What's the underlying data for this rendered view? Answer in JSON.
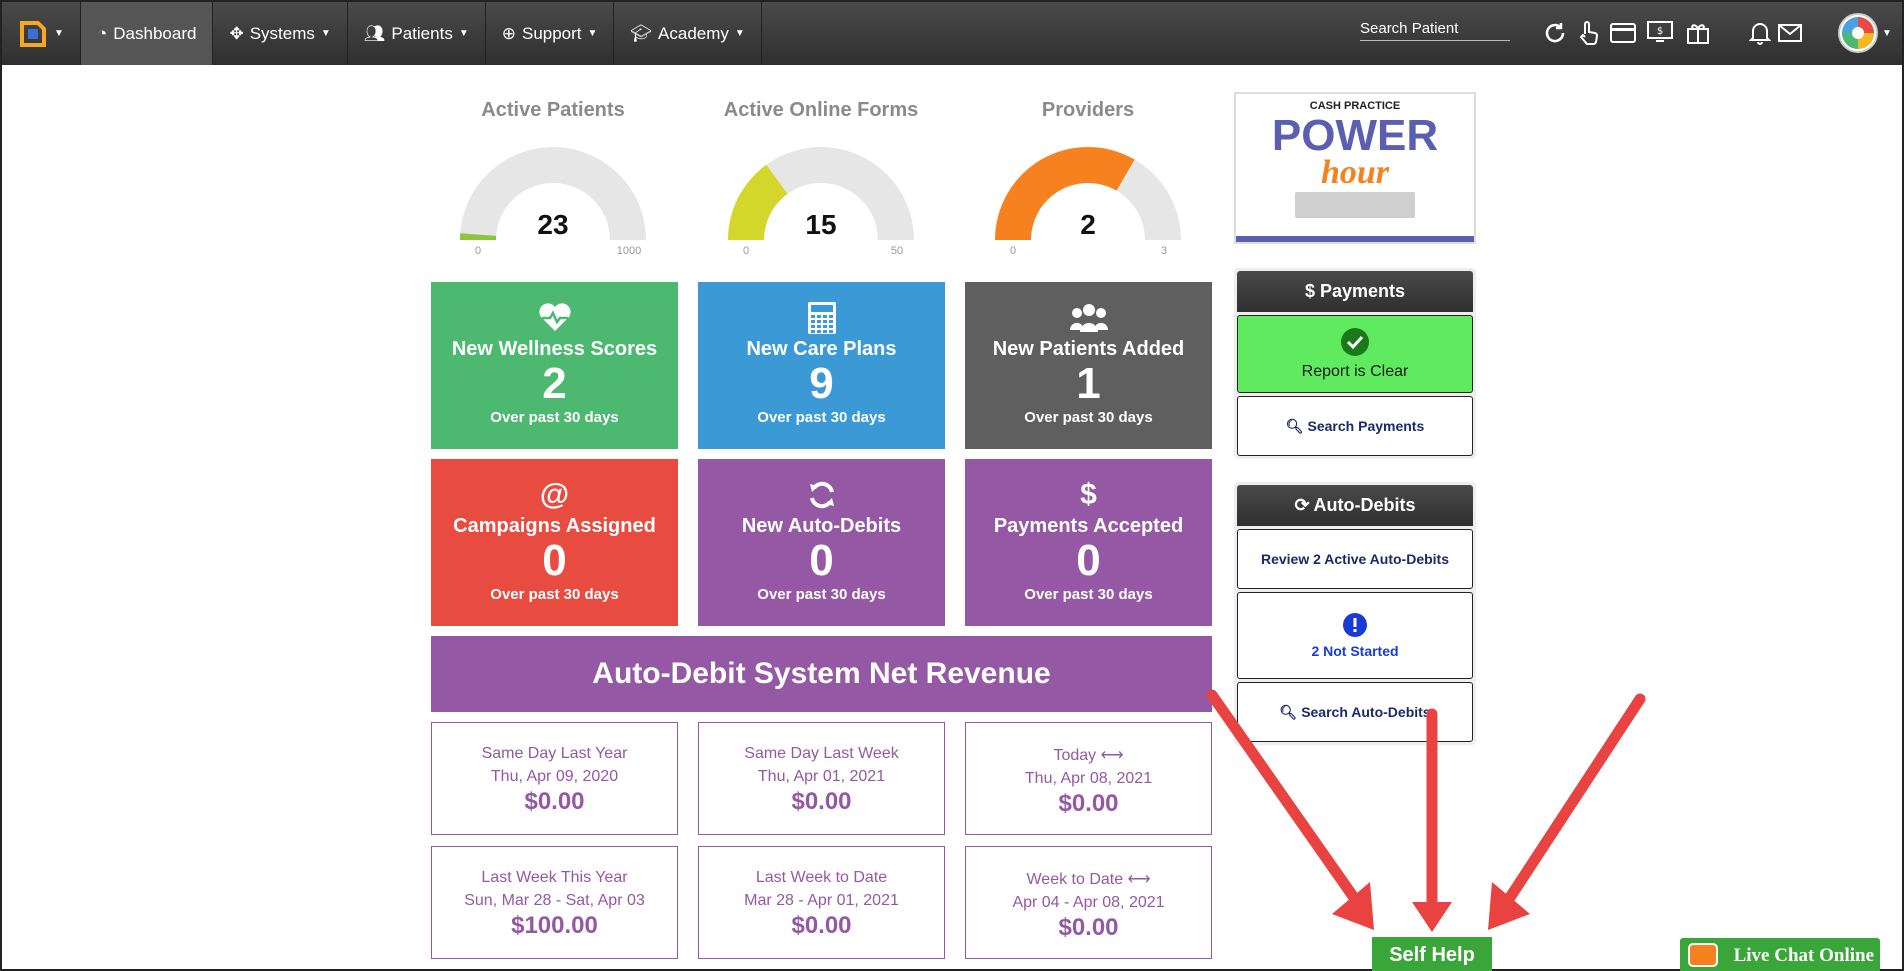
{
  "nav": {
    "items": [
      {
        "label": "Dashboard",
        "icon": "dashboard-icon"
      },
      {
        "label": "Systems",
        "icon": "puzzle-icon"
      },
      {
        "label": "Patients",
        "icon": "users-icon"
      },
      {
        "label": "Support",
        "icon": "lifebuoy-icon"
      },
      {
        "label": "Academy",
        "icon": "graduation-cap-icon"
      }
    ],
    "search_placeholder": "Search Patient"
  },
  "gauges": [
    {
      "title": "Active Patients",
      "value": "23",
      "min": "0",
      "max": "1000",
      "fraction": 0.023,
      "color": "#8cc63f"
    },
    {
      "title": "Active Online Forms",
      "value": "15",
      "min": "0",
      "max": "50",
      "fraction": 0.3,
      "color": "#d4d62b"
    },
    {
      "title": "Providers",
      "value": "2",
      "min": "0",
      "max": "3",
      "fraction": 0.667,
      "color": "#f5821f"
    }
  ],
  "tiles": [
    {
      "title": "New Wellness Scores",
      "value": "2",
      "sub": "Over past 30 days",
      "color": "#4cb870",
      "icon": "heartbeat-icon"
    },
    {
      "title": "New Care Plans",
      "value": "9",
      "sub": "Over past 30 days",
      "color": "#3b9ad6",
      "icon": "calculator-icon"
    },
    {
      "title": "New Patients Added",
      "value": "1",
      "sub": "Over past 30 days",
      "color": "#5f5f5f",
      "icon": "users-icon"
    },
    {
      "title": "Campaigns Assigned",
      "value": "0",
      "sub": "Over past 30 days",
      "color": "#e84b40",
      "icon": "at-icon",
      "glyph": "@"
    },
    {
      "title": "New Auto-Debits",
      "value": "0",
      "sub": "Over past 30 days",
      "color": "#9558a4",
      "icon": "refresh-icon"
    },
    {
      "title": "Payments Accepted",
      "value": "0",
      "sub": "Over past 30 days",
      "color": "#9558a4",
      "icon": "dollar-icon",
      "glyph": "$"
    }
  ],
  "revenue": {
    "banner": "Auto-Debit System Net Revenue",
    "cards": [
      {
        "label": "Same Day Last Year",
        "date": "Thu, Apr 09, 2020",
        "amount": "$0.00"
      },
      {
        "label": "Same Day Last Week",
        "date": "Thu, Apr 01, 2021",
        "amount": "$0.00"
      },
      {
        "label": "Today ⟷",
        "date": "Thu, Apr 08, 2021",
        "amount": "$0.00"
      },
      {
        "label": "Last Week This Year",
        "date": "Sun, Mar 28 - Sat, Apr 03",
        "amount": "$100.00"
      },
      {
        "label": "Last Week to Date",
        "date": "Mar 28 - Apr 01, 2021",
        "amount": "$0.00"
      },
      {
        "label": "Week to Date ⟷",
        "date": "Apr 04 - Apr 08, 2021",
        "amount": "$0.00"
      }
    ]
  },
  "promo": {
    "brand": "CASH PRACTICE",
    "word1": "POWER",
    "word2": "hour"
  },
  "payments": {
    "title": "$ Payments",
    "status": "Report is Clear",
    "search": "Search Payments"
  },
  "autodebits": {
    "title": "Auto-Debits",
    "review": "Review 2 Active Auto-Debits",
    "not_started": "2 Not Started",
    "search": "Search Auto-Debits"
  },
  "self_help": "Self Help",
  "live_chat": "Live Chat Online"
}
